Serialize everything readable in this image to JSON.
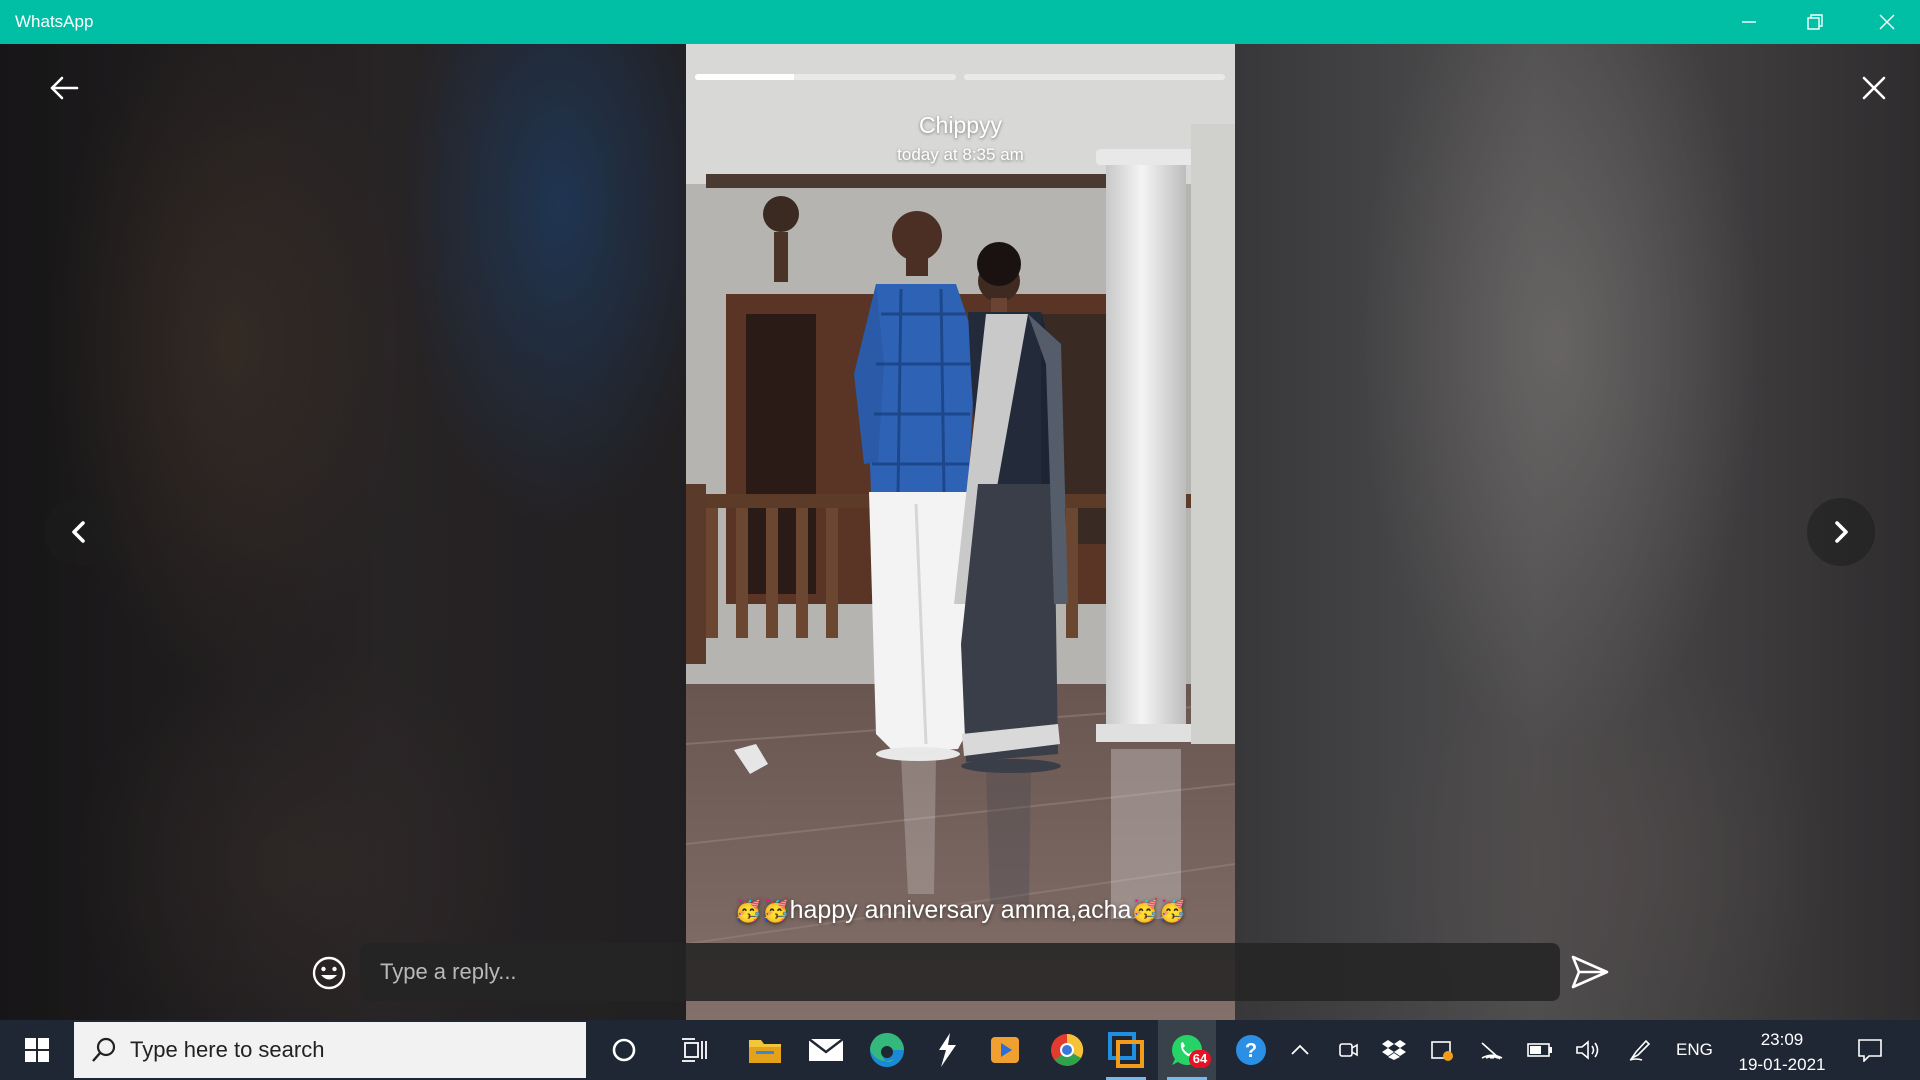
{
  "window": {
    "title": "WhatsApp",
    "accent_color": "#00bfa5",
    "controls": [
      "minimize-icon",
      "restore-icon",
      "close-icon"
    ]
  },
  "status_viewer": {
    "contact_name": "Chippyy",
    "timestamp": "today at 8:35 am",
    "caption": {
      "emoji_prefix": "🥳🥳",
      "text": "happy anniversary amma,acha",
      "emoji_suffix": "🥳🥳"
    },
    "progress": [
      {
        "segment": 1,
        "fraction_complete": 0.38
      },
      {
        "segment": 2,
        "fraction_complete": 0
      }
    ],
    "navigation_icons": [
      "back-arrow-icon",
      "close-viewer-icon",
      "previous-status-icon",
      "next-status-icon"
    ]
  },
  "reply": {
    "placeholder": "Type a reply...",
    "value": "",
    "emoji_icon": "smiley-icon",
    "send_icon": "send-icon"
  },
  "taskbar": {
    "search_placeholder": "Type here to search",
    "apps": [
      "windows-start-icon",
      "cortana-icon",
      "task-view-icon",
      "file-explorer-icon",
      "mail-icon",
      "edge-icon",
      "winamp-icon",
      "media-player-icon",
      "chrome-icon",
      "snip-tool-icon",
      "whatsapp-icon",
      "help-icon"
    ],
    "whatsapp_badge": "64",
    "tray_icons": [
      "show-hidden-icons-chevron",
      "meet-now-icon",
      "dropbox-icon",
      "screen-sketch-icon",
      "wifi-icon",
      "battery-icon",
      "volume-icon",
      "pen-icon"
    ],
    "language": "ENG",
    "time": "23:09",
    "date": "19-01-2021"
  }
}
